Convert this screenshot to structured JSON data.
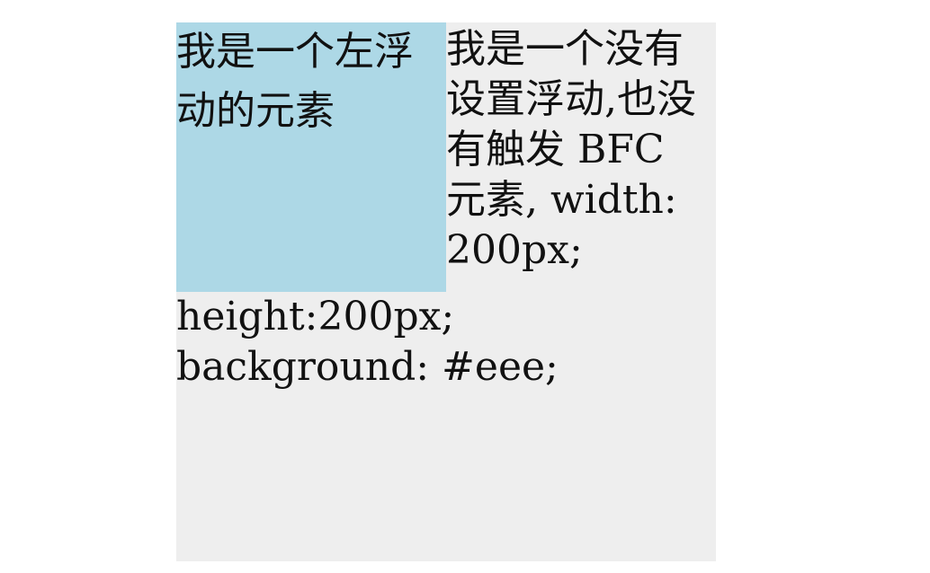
{
  "page": {
    "float_element_text": "我是一个左浮动的元素",
    "non_float_text": "我是一个没有设置浮动,也没有触发 BFC 元素, width: 200px; height:200px; background: #eee;"
  },
  "colors": {
    "float_bg": "#add8e6",
    "container_bg": "#eeeeee",
    "page_bg": "#ffffff",
    "text": "#111111"
  }
}
